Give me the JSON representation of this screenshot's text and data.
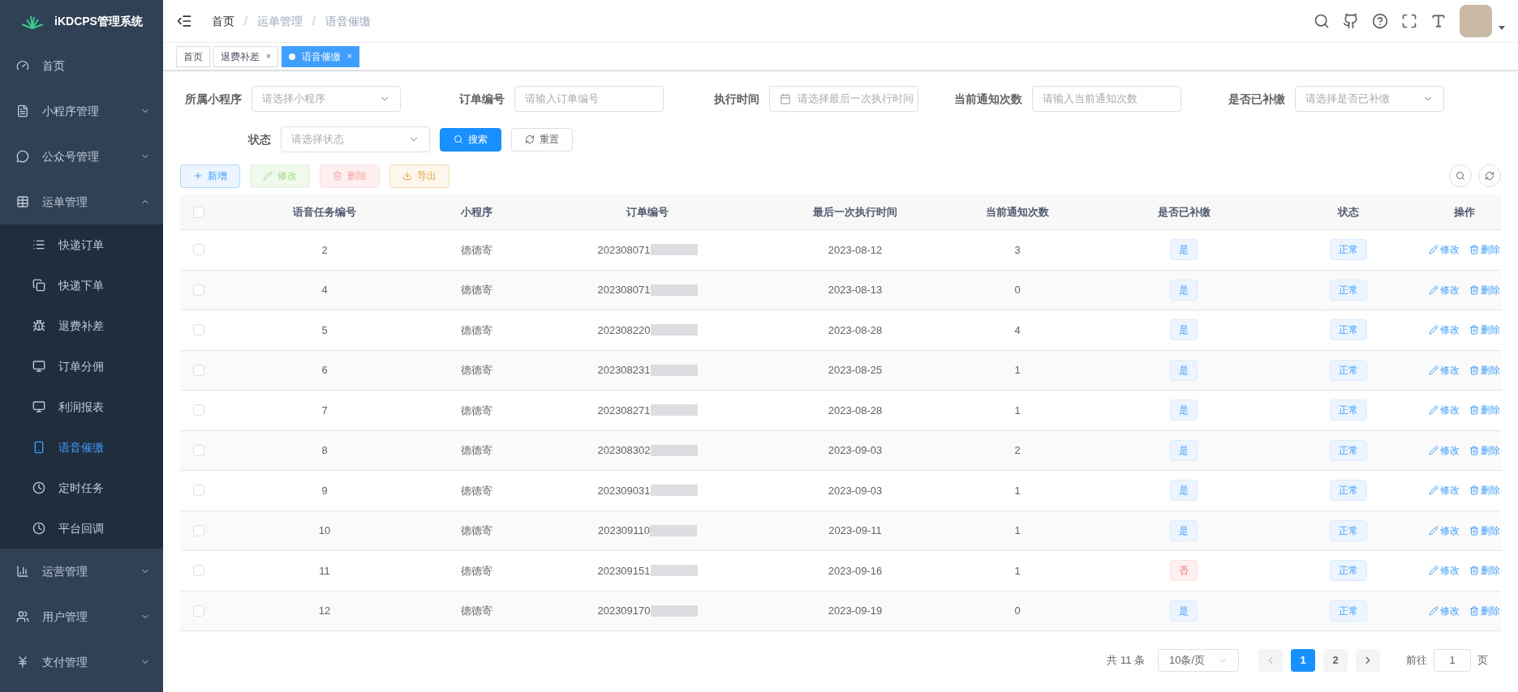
{
  "app": {
    "title": "iKDCPS管理系统"
  },
  "sidebar": {
    "items": [
      {
        "label": "首页",
        "selected": false
      },
      {
        "label": "小程序管理",
        "expanded": false
      },
      {
        "label": "公众号管理",
        "expanded": false
      },
      {
        "label": "运单管理",
        "expanded": true,
        "children": [
          {
            "label": "快递订单",
            "selected": false
          },
          {
            "label": "快递下单",
            "selected": false
          },
          {
            "label": "退费补差",
            "selected": false
          },
          {
            "label": "订单分佣",
            "selected": false
          },
          {
            "label": "利润报表",
            "selected": false
          },
          {
            "label": "语音催缴",
            "selected": true
          },
          {
            "label": "定时任务",
            "selected": false
          },
          {
            "label": "平台回调",
            "selected": false
          }
        ]
      },
      {
        "label": "运营管理",
        "expanded": false
      },
      {
        "label": "用户管理",
        "expanded": false
      },
      {
        "label": "支付管理",
        "expanded": false
      }
    ]
  },
  "breadcrumb": {
    "separator": "/",
    "items": [
      "首页",
      "运单管理",
      "语音催缴"
    ]
  },
  "tabs": [
    {
      "label": "首页",
      "selected": false
    },
    {
      "label": "退费补差",
      "selected": false,
      "close": "×"
    },
    {
      "label": "语音催缴",
      "selected": true,
      "close": "×"
    }
  ],
  "filters": [
    {
      "label": "所属小程序",
      "kind": "select",
      "placeholder": "请选择小程序"
    },
    {
      "label": "订单编号",
      "kind": "input",
      "placeholder": "请输入订单编号"
    },
    {
      "label": "执行时间",
      "kind": "date",
      "placeholder": "请选择最后一次执行时间"
    },
    {
      "label": "当前通知次数",
      "kind": "input",
      "placeholder": "请输入当前通知次数"
    },
    {
      "label": "是否已补缴",
      "kind": "select",
      "placeholder": "请选择是否已补缴"
    },
    {
      "label": "状态",
      "kind": "select",
      "placeholder": "请选择状态"
    }
  ],
  "filter_buttons": [
    {
      "label": "搜索",
      "kind": "primary"
    },
    {
      "label": "重置",
      "kind": "plain"
    }
  ],
  "toolbar": [
    {
      "label": "新增",
      "kind": "add",
      "disabled": false
    },
    {
      "label": "修改",
      "kind": "edit",
      "disabled": true
    },
    {
      "label": "删除",
      "kind": "delete",
      "disabled": true
    },
    {
      "label": "导出",
      "kind": "export",
      "disabled": false
    }
  ],
  "table": {
    "header_checked": false,
    "columns": [
      "语音任务编号",
      "小程序",
      "订单编号",
      "最后一次执行时间",
      "当前通知次数",
      "是否已补缴",
      "状态",
      "操作"
    ],
    "rows": [
      {
        "checked": false,
        "id": "2",
        "app": "德德寄",
        "order": "202308071",
        "time": "2023-08-12",
        "count": "3",
        "paid": true,
        "paid_label": "是",
        "status": "正常",
        "actions": [
          "修改",
          "删除"
        ]
      },
      {
        "checked": false,
        "id": "4",
        "app": "德德寄",
        "order": "202308071",
        "time": "2023-08-13",
        "count": "0",
        "paid": true,
        "paid_label": "是",
        "status": "正常",
        "actions": [
          "修改",
          "删除"
        ]
      },
      {
        "checked": false,
        "id": "5",
        "app": "德德寄",
        "order": "202308220",
        "time": "2023-08-28",
        "count": "4",
        "paid": true,
        "paid_label": "是",
        "status": "正常",
        "actions": [
          "修改",
          "删除"
        ]
      },
      {
        "checked": false,
        "id": "6",
        "app": "德德寄",
        "order": "202308231",
        "time": "2023-08-25",
        "count": "1",
        "paid": true,
        "paid_label": "是",
        "status": "正常",
        "actions": [
          "修改",
          "删除"
        ]
      },
      {
        "checked": false,
        "id": "7",
        "app": "德德寄",
        "order": "202308271",
        "time": "2023-08-28",
        "count": "1",
        "paid": true,
        "paid_label": "是",
        "status": "正常",
        "actions": [
          "修改",
          "删除"
        ]
      },
      {
        "checked": false,
        "id": "8",
        "app": "德德寄",
        "order": "202308302",
        "time": "2023-09-03",
        "count": "2",
        "paid": true,
        "paid_label": "是",
        "status": "正常",
        "actions": [
          "修改",
          "删除"
        ]
      },
      {
        "checked": false,
        "id": "9",
        "app": "德德寄",
        "order": "202309031",
        "time": "2023-09-03",
        "count": "1",
        "paid": true,
        "paid_label": "是",
        "status": "正常",
        "actions": [
          "修改",
          "删除"
        ]
      },
      {
        "checked": false,
        "id": "10",
        "app": "德德寄",
        "order": "202309110",
        "time": "2023-09-11",
        "count": "1",
        "paid": true,
        "paid_label": "是",
        "status": "正常",
        "actions": [
          "修改",
          "删除"
        ]
      },
      {
        "checked": false,
        "id": "11",
        "app": "德德寄",
        "order": "202309151",
        "time": "2023-09-16",
        "count": "1",
        "paid": false,
        "paid_label": "否",
        "status": "正常",
        "actions": [
          "修改",
          "删除"
        ]
      },
      {
        "checked": false,
        "id": "12",
        "app": "德德寄",
        "order": "202309170",
        "time": "2023-09-19",
        "count": "0",
        "paid": true,
        "paid_label": "是",
        "status": "正常",
        "actions": [
          "修改",
          "删除"
        ]
      }
    ]
  },
  "pagination": {
    "total": "共 11 条",
    "page_size": "10条/页",
    "pages": [
      {
        "label": "1",
        "selected": true
      },
      {
        "label": "2",
        "selected": false
      }
    ],
    "goto_label": "前往",
    "goto_value": "1",
    "goto_suffix": "页"
  }
}
